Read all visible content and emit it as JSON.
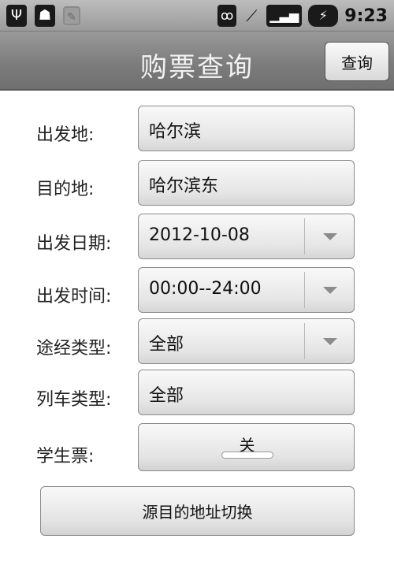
{
  "status_bar": {
    "icons": [
      "usb-icon",
      "android-icon",
      "leaf-icon",
      "wifi-icon",
      "vibrate-icon",
      "signal-icon",
      "battery-icon"
    ],
    "time": "9:23"
  },
  "header": {
    "title": "购票查询",
    "query_button": "查询"
  },
  "form": {
    "departure": {
      "label": "出发地:",
      "value": "哈尔滨"
    },
    "destination": {
      "label": "目的地:",
      "value": "哈尔滨东"
    },
    "date": {
      "label": "出发日期:",
      "value": "2012-10-08"
    },
    "time": {
      "label": "出发时间:",
      "value": "00:00--24:00"
    },
    "route_type": {
      "label": "途经类型:",
      "value": "全部"
    },
    "train_type": {
      "label": "列车类型:",
      "value": "全部"
    },
    "student": {
      "label": "学生票:",
      "value": "关"
    }
  },
  "swap_button": "源目的地址切换",
  "colors": {
    "header": "#7d7d7d",
    "status_bar": "#a6a6a6",
    "background": "#ffffff"
  }
}
